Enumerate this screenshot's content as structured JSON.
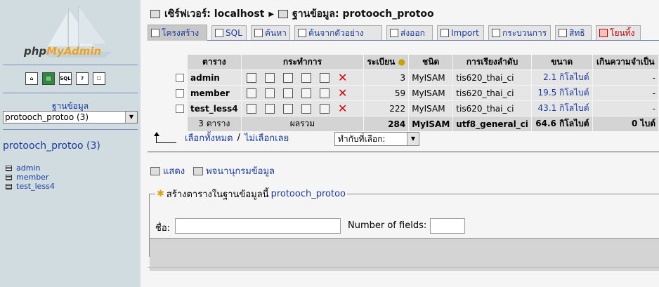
{
  "sidebar": {
    "logo": {
      "prefix": "php",
      "accent": "MyAdmin"
    },
    "quick_icons": [
      "home-icon",
      "query-window-icon",
      "sql-icon",
      "docs-icon",
      "help-icon"
    ],
    "db_label": "ฐานข้อมูล",
    "db_select_value": "protooch_protoo (3)",
    "db_title": "protooch_protoo (3)",
    "tables": [
      "admin",
      "member",
      "test_less4"
    ]
  },
  "breadcrumb": {
    "server": "เซิร์ฟเวอร์: localhost",
    "database": "ฐานข้อมูล: protooch_protoo"
  },
  "tabs": [
    {
      "label": "โครงสร้าง",
      "icon": "structure-icon"
    },
    {
      "label": "SQL",
      "icon": "sql-icon"
    },
    {
      "label": "ค้นหา",
      "icon": "search-icon"
    },
    {
      "label": "ค้นจากตัวอย่าง",
      "icon": "query-icon"
    },
    {
      "label": "ส่งออก",
      "icon": "export-icon"
    },
    {
      "label": "Import",
      "icon": "import-icon"
    },
    {
      "label": "กระบวนการ",
      "icon": "operations-icon"
    },
    {
      "label": "สิทธิ",
      "icon": "privileges-icon"
    },
    {
      "label": "โยนทิ้ง",
      "icon": "drop-icon"
    }
  ],
  "table": {
    "headers": [
      "ตาราง",
      "กระทำการ",
      "ระเบียน",
      "ชนิด",
      "การเรียงลำดับ",
      "ขนาด",
      "เกินความจำเป็น"
    ],
    "rows": [
      {
        "name": "admin",
        "records": "3",
        "type": "MyISAM",
        "collation": "tis620_thai_ci",
        "size": "2.1 กิโลไบต์",
        "overhead": "-"
      },
      {
        "name": "member",
        "records": "59",
        "type": "MyISAM",
        "collation": "tis620_thai_ci",
        "size": "19.5 กิโลไบต์",
        "overhead": "-"
      },
      {
        "name": "test_less4",
        "records": "222",
        "type": "MyISAM",
        "collation": "tis620_thai_ci",
        "size": "43.1 กิโลไบต์",
        "overhead": "-"
      }
    ],
    "summary": {
      "tables": "3 ตาราง",
      "label": "ผลรวม",
      "records": "284",
      "type": "MyISAM",
      "collation": "utf8_general_ci",
      "size": "64.6 กิโลไบต์",
      "overhead": "0 ไบต์"
    }
  },
  "selection": {
    "check_all": "เลือกทั้งหมด",
    "separator": "/",
    "uncheck_all": "ไม่เลือกเลย",
    "with_selected": "ทำกับที่เลือก:"
  },
  "links": {
    "print": "แสดง",
    "dictionary": "พจนานุกรมข้อมูล"
  },
  "create_table": {
    "legend": "สร้างตารางในฐานข้อมูลนี้",
    "db": "protooch_protoo",
    "name_label": "ชื่อ:",
    "fields_label": "Number of fields:"
  }
}
